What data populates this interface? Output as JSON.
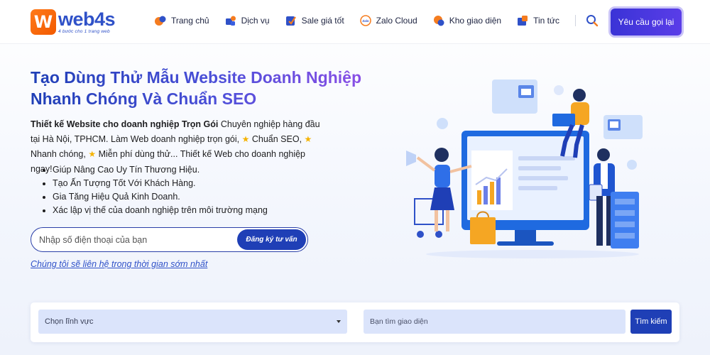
{
  "header": {
    "logo": {
      "mark": "W",
      "name": "web4s",
      "tagline": "4 bước cho 1 trang web"
    },
    "nav": [
      {
        "label": "Trang chủ",
        "icon": "home-icon"
      },
      {
        "label": "Dịch vụ",
        "icon": "puzzle-icon"
      },
      {
        "label": "Sale giá tốt",
        "icon": "sale-tag-icon"
      },
      {
        "label": "Zalo Cloud",
        "icon": "zalo-icon"
      },
      {
        "label": "Kho giao diện",
        "icon": "theme-store-icon"
      },
      {
        "label": "Tin tức",
        "icon": "news-icon"
      }
    ],
    "search_icon": "search-icon",
    "cta_label": "Yêu cầu gọi lại"
  },
  "hero": {
    "title": "Tạo Dùng Thử Mẫu Website Doanh Nghiệp Nhanh Chóng Và Chuẩn SEO",
    "desc_bold": "Thiết kế Website cho doanh nghiệp Trọn Gói",
    "desc_rest": " Chuyên nghiệp hàng đầu tại Hà Nội, TPHCM. Làm Web doanh nghiệp trọn gói,",
    "desc_seo": " Chuẩn SEO,",
    "desc_fast": " Nhanh chóng,",
    "desc_free": " Miễn phí dùng thử... Thiết kế Web cho doanh nghiệp ngay!",
    "star": "★",
    "bullets": [
      "Giúp Nâng Cao Uy Tín Thương Hiệu.",
      "Tạo Ấn Tượng Tốt Với Khách Hàng.",
      "Gia Tăng Hiệu Quả Kinh Doanh.",
      "Xác lập vị thế của doanh nghiệp trên môi trường mạng"
    ],
    "phone_placeholder": "Nhập số điện thoại của bạn",
    "phone_submit": "Đăng ký tư vấn",
    "contact_note": "Chúng tôi sẽ liên hệ trong thời gian sớm nhất"
  },
  "search": {
    "category_placeholder": "Chọn lĩnh vực",
    "theme_placeholder": "Bạn tìm giao diện",
    "submit": "Tìm kiếm"
  },
  "colors": {
    "brand_blue": "#1f3fb6",
    "brand_orange": "#f25a00",
    "accent_purple": "#5a3de8"
  }
}
